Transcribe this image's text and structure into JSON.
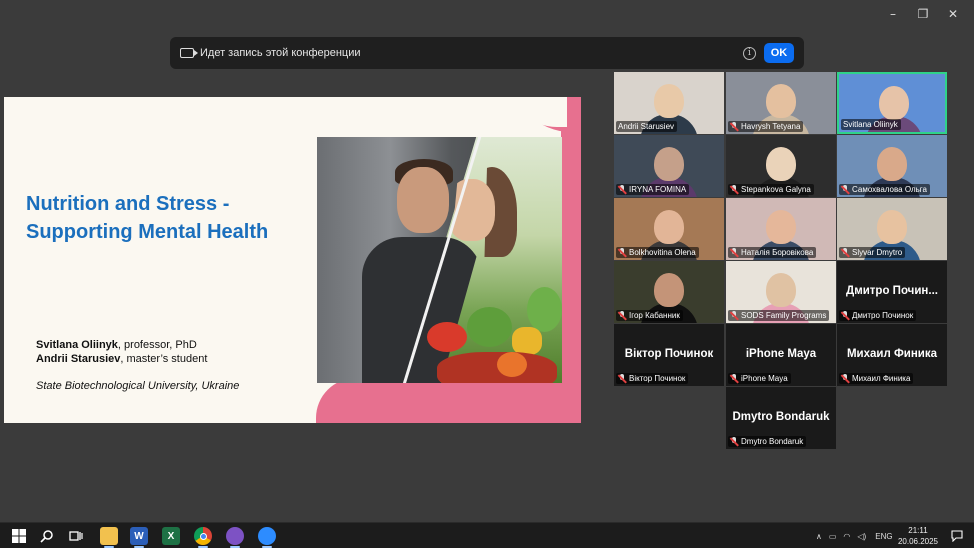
{
  "window": {
    "controls": {
      "minimize": "–",
      "restore": "❐",
      "close": "✕"
    }
  },
  "banner": {
    "text": "Идет запись этой конференции",
    "info_icon": "i",
    "ok_label": "OK"
  },
  "slide": {
    "title_line1": "Nutrition and Stress -",
    "title_line2": "Supporting Mental Health",
    "author1_name": "Svitlana Oliinyk",
    "author1_role": ", professor, PhD",
    "author2_name": "Andrii Starusiev",
    "author2_role": ", master’s student",
    "university": "State Biotechnological University, Ukraine",
    "title_color": "#1b6fbd",
    "accent_color": "#e7708f"
  },
  "participants": [
    {
      "name": "Andrii Starusiev",
      "video": true
    },
    {
      "name": "Havrysh Tetyana",
      "video": true
    },
    {
      "name": "Svitlana Oliinyk",
      "video": true,
      "active": true
    },
    {
      "name": "IRYNA FOMINA",
      "video": true
    },
    {
      "name": "Stepankova Galyna",
      "video": true
    },
    {
      "name": "Самохвалова Ольга",
      "video": true
    },
    {
      "name": "Bolkhovitina Olena",
      "video": true
    },
    {
      "name": "Наталія Боровікова",
      "video": true
    },
    {
      "name": "Slyvar Dmytro",
      "video": true
    },
    {
      "name": "Ігор Кабанник",
      "video": true
    },
    {
      "name": "SODS Family Programs",
      "video": true
    },
    {
      "name": "Дмитро Починок",
      "display_name": "Дмитро Почин...",
      "video": false
    },
    {
      "name": "Віктор Починок",
      "display_name": "Віктор Починок",
      "video": false
    },
    {
      "name": "iPhone Maya",
      "display_name": "iPhone Maya",
      "video": false
    },
    {
      "name": "Михаил Финика",
      "display_name": "Михаил Финика",
      "video": false
    },
    {
      "name": "Dmytro Bondaruk",
      "display_name": "Dmytro Bondaruk",
      "video": false
    }
  ],
  "taskbar": {
    "apps": [
      "windows-start",
      "search",
      "task-view",
      "file-explorer",
      "word",
      "excel",
      "chrome",
      "viber",
      "zoom"
    ],
    "word_letter": "W",
    "excel_letter": "X",
    "language": "ENG",
    "time": "21:11",
    "date": "20.06.2025"
  },
  "colors": {
    "active_speaker_border": "#2fd28a",
    "ok_button": "#0b6cf0"
  }
}
